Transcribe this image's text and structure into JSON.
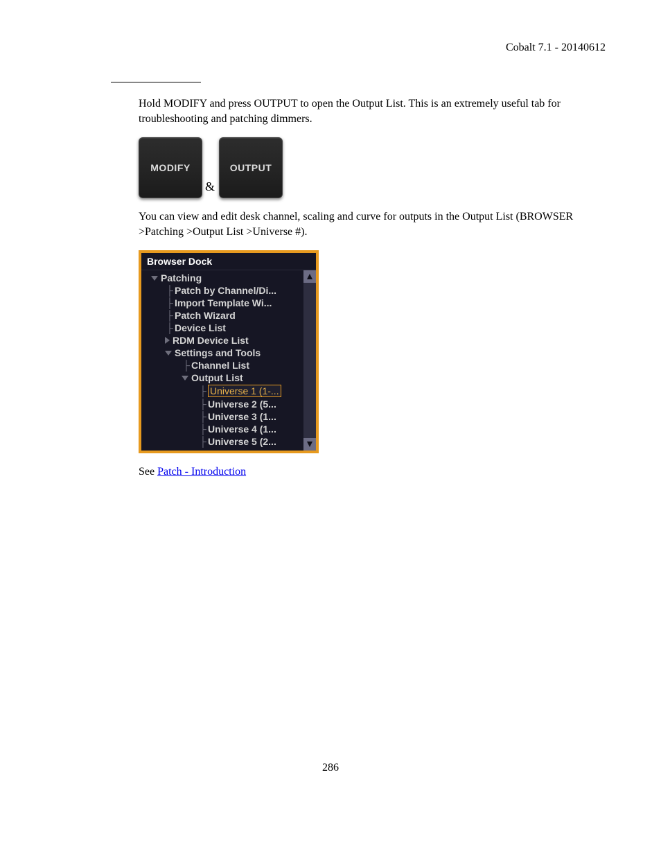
{
  "header": {
    "version": "Cobalt 7.1 - 20140612"
  },
  "paragraphs": {
    "intro": "Hold MODIFY and press OUTPUT to open the Output List. This is an extremely useful tab for troubleshooting and patching dimmers.",
    "amp": "&",
    "view_edit": "You can view and edit desk channel, scaling and curve for outputs in the Output List (BROWSER >Patching >Output List >Universe #).",
    "see_prefix": "See ",
    "see_link": "Patch - Introduction"
  },
  "keys": {
    "modify": "MODIFY",
    "output": "OUTPUT"
  },
  "browser_dock": {
    "title": "Browser Dock",
    "root": "Patching",
    "items": [
      "Patch by Channel/Di...",
      "Import Template Wi...",
      "Patch Wizard",
      "Device List"
    ],
    "rdm": "RDM Device List",
    "settings": "Settings and Tools",
    "channel_list": "Channel List",
    "output_list": "Output List",
    "universes": [
      "Universe 1 (1-...",
      "Universe 2 (5...",
      "Universe 3 (1...",
      "Universe 4 (1...",
      "Universe 5 (2..."
    ]
  },
  "page_number": "286"
}
